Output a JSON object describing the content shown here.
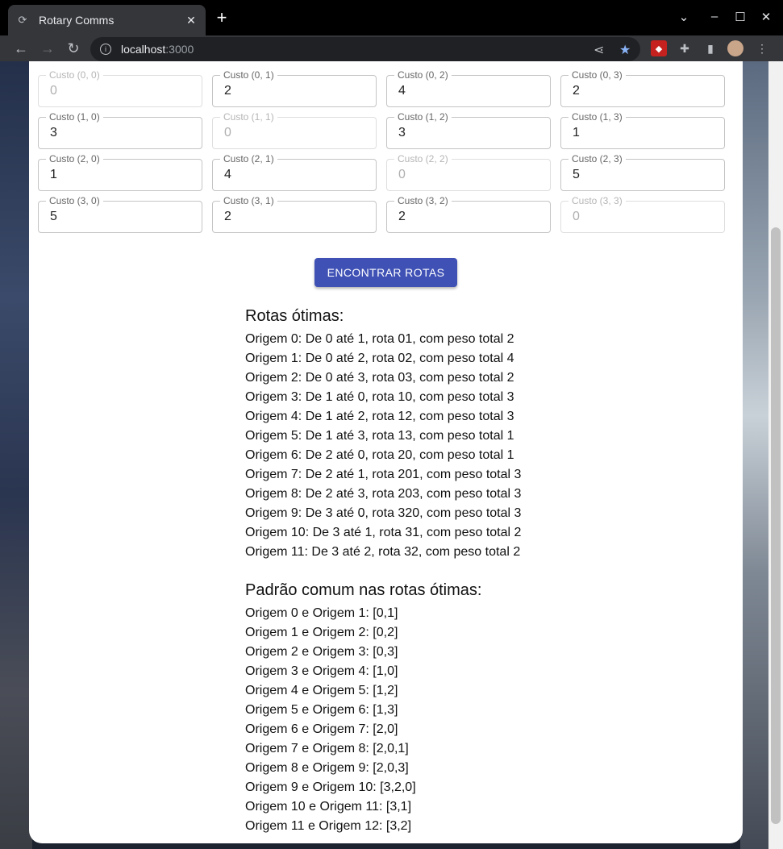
{
  "browser": {
    "tab_title": "Rotary Comms",
    "url_host": "localhost",
    "url_port": ":3000"
  },
  "grid": [
    {
      "label": "Custo (0, 0)",
      "value": "0",
      "disabled": true
    },
    {
      "label": "Custo (0, 1)",
      "value": "2",
      "disabled": false
    },
    {
      "label": "Custo (0, 2)",
      "value": "4",
      "disabled": false
    },
    {
      "label": "Custo (0, 3)",
      "value": "2",
      "disabled": false
    },
    {
      "label": "Custo (1, 0)",
      "value": "3",
      "disabled": false
    },
    {
      "label": "Custo (1, 1)",
      "value": "0",
      "disabled": true
    },
    {
      "label": "Custo (1, 2)",
      "value": "3",
      "disabled": false
    },
    {
      "label": "Custo (1, 3)",
      "value": "1",
      "disabled": false
    },
    {
      "label": "Custo (2, 0)",
      "value": "1",
      "disabled": false
    },
    {
      "label": "Custo (2, 1)",
      "value": "4",
      "disabled": false
    },
    {
      "label": "Custo (2, 2)",
      "value": "0",
      "disabled": true
    },
    {
      "label": "Custo (2, 3)",
      "value": "5",
      "disabled": false
    },
    {
      "label": "Custo (3, 0)",
      "value": "5",
      "disabled": false
    },
    {
      "label": "Custo (3, 1)",
      "value": "2",
      "disabled": false
    },
    {
      "label": "Custo (3, 2)",
      "value": "2",
      "disabled": false
    },
    {
      "label": "Custo (3, 3)",
      "value": "0",
      "disabled": true
    }
  ],
  "button_label": "ENCONTRAR ROTAS",
  "optimal_routes": {
    "heading": "Rotas ótimas:",
    "lines": [
      "Origem 0: De 0 até 1, rota 01, com peso total 2",
      "Origem 1: De 0 até 2, rota 02, com peso total 4",
      "Origem 2: De 0 até 3, rota 03, com peso total 2",
      "Origem 3: De 1 até 0, rota 10, com peso total 3",
      "Origem 4: De 1 até 2, rota 12, com peso total 3",
      "Origem 5: De 1 até 3, rota 13, com peso total 1",
      "Origem 6: De 2 até 0, rota 20, com peso total 1",
      "Origem 7: De 2 até 1, rota 201, com peso total 3",
      "Origem 8: De 2 até 3, rota 203, com peso total 3",
      "Origem 9: De 3 até 0, rota 320, com peso total 3",
      "Origem 10: De 3 até 1, rota 31, com peso total 2",
      "Origem 11: De 3 até 2, rota 32, com peso total 2"
    ]
  },
  "common_pattern": {
    "heading": "Padrão comum nas rotas ótimas:",
    "lines": [
      "Origem 0 e Origem 1: [0,1]",
      "Origem 1 e Origem 2: [0,2]",
      "Origem 2 e Origem 3: [0,3]",
      "Origem 3 e Origem 4: [1,0]",
      "Origem 4 e Origem 5: [1,2]",
      "Origem 5 e Origem 6: [1,3]",
      "Origem 6 e Origem 7: [2,0]",
      "Origem 7 e Origem 8: [2,0,1]",
      "Origem 8 e Origem 9: [2,0,3]",
      "Origem 9 e Origem 10: [3,2,0]",
      "Origem 10 e Origem 11: [3,1]",
      "Origem 11 e Origem 12: [3,2]"
    ]
  }
}
